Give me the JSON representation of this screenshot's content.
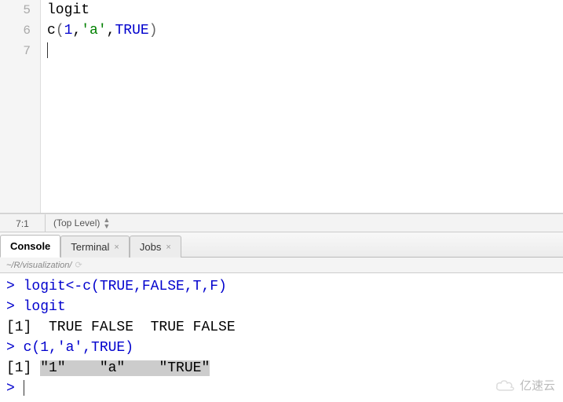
{
  "editor": {
    "gutter": [
      "5",
      "6",
      "7"
    ],
    "line5": "logit",
    "line6": {
      "fn": "c",
      "open": "(",
      "a1": "1",
      "c1": ",",
      "a2": "'a'",
      "c2": ",",
      "a3": "TRUE",
      "close": ")"
    }
  },
  "status": {
    "pos": "7:1",
    "scope": "(Top Level)"
  },
  "tabs": {
    "console": "Console",
    "terminal": "Terminal",
    "jobs": "Jobs"
  },
  "path": "~/R/visualization/",
  "console": {
    "l1": {
      "prompt": "> ",
      "code": "logit<-c(TRUE,FALSE,T,F)"
    },
    "l2": {
      "prompt": "> ",
      "code": "logit"
    },
    "l3": {
      "idx": "[1]",
      "out": "  TRUE FALSE  TRUE FALSE"
    },
    "l4": {
      "prompt": "> ",
      "code": "c(1,'a',TRUE)"
    },
    "l5": {
      "idx": "[1]",
      "pad": " ",
      "hl": "\"1\"    \"a\"    \"TRUE\""
    },
    "l6": {
      "prompt": "> "
    }
  },
  "watermark": "亿速云"
}
